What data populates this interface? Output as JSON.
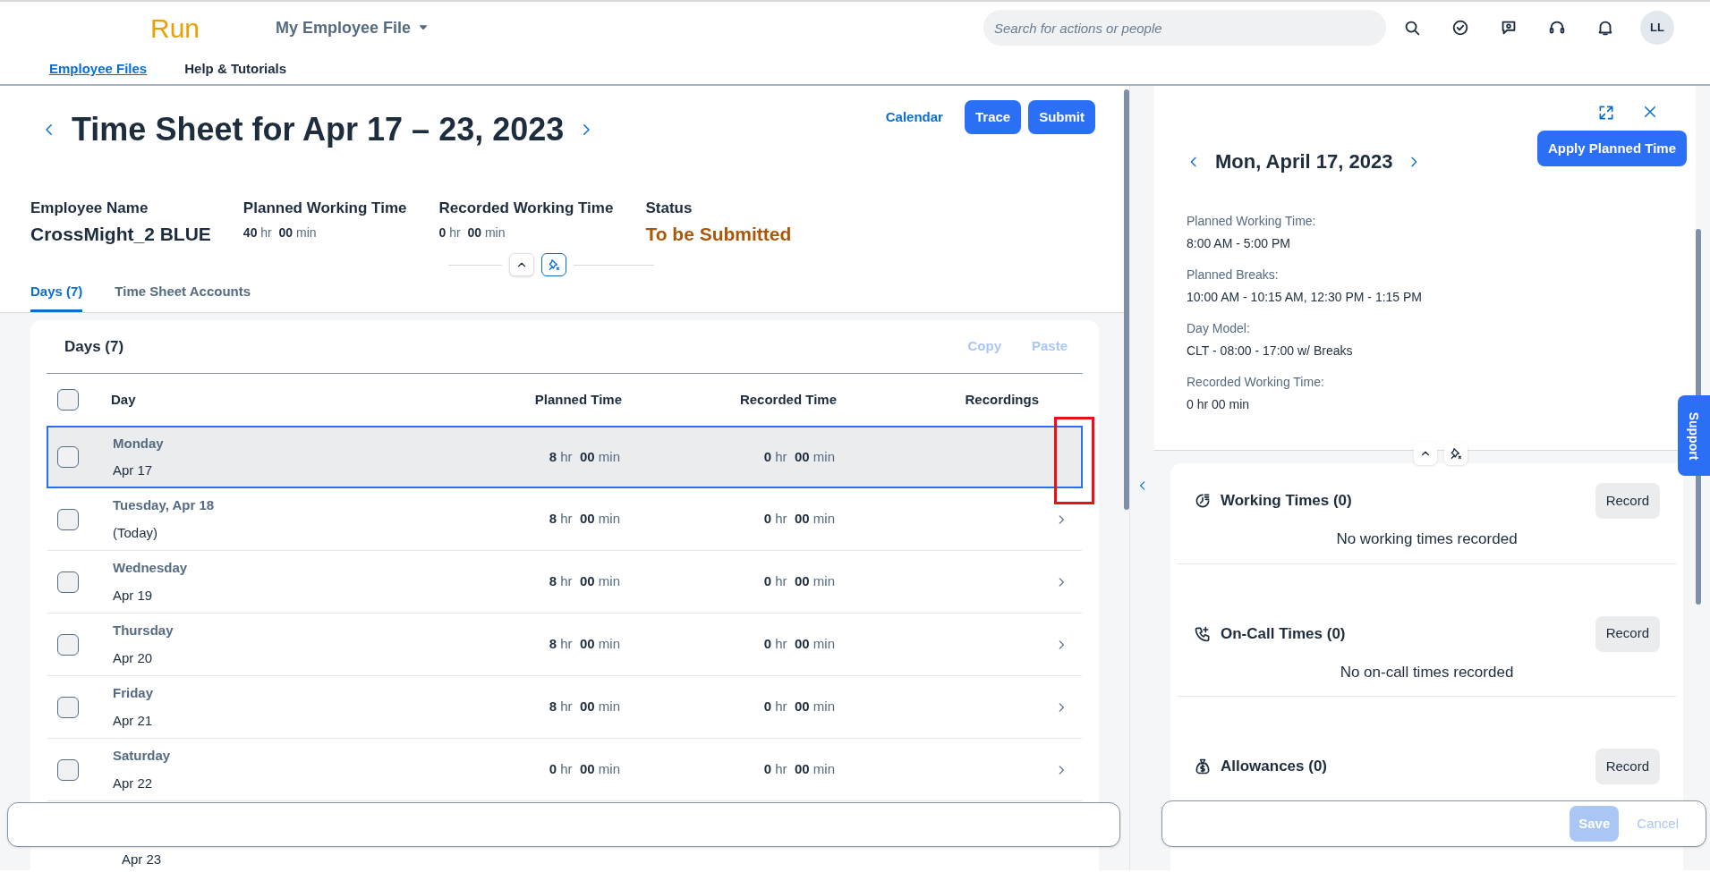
{
  "shell": {
    "logo": "Run",
    "app_menu": "My Employee File",
    "search": {
      "placeholder": "Search for actions or people"
    },
    "avatar": "LL",
    "nav": [
      {
        "label": "Employee Files",
        "selected": true
      },
      {
        "label": "Help & Tutorials",
        "selected": false
      }
    ]
  },
  "sheet": {
    "title": "Time Sheet for Apr 17 – 23, 2023",
    "actions": {
      "calendar": "Calendar",
      "trace": "Trace",
      "submit": "Submit"
    },
    "info": [
      {
        "label": "Employee Name",
        "kind": "name",
        "value": "CrossMight_2 BLUE"
      },
      {
        "label": "Planned Working Time",
        "kind": "duration",
        "hr": "40",
        "hr_unit": "hr",
        "min": "00",
        "min_unit": "min"
      },
      {
        "label": "Recorded Working Time",
        "kind": "duration",
        "hr": "0",
        "hr_unit": "hr",
        "min": "00",
        "min_unit": "min"
      },
      {
        "label": "Status",
        "kind": "status",
        "value": "To be Submitted"
      }
    ],
    "tabs": [
      {
        "label": "Days (7)",
        "selected": true
      },
      {
        "label": "Time Sheet Accounts",
        "selected": false
      }
    ],
    "days": {
      "title": "Days (7)",
      "copy": "Copy",
      "paste": "Paste",
      "header_checked": false,
      "columns": [
        "Day",
        "Planned Time",
        "Recorded Time",
        "Recordings"
      ],
      "rows": [
        {
          "day": "Monday",
          "sub": "Apr 17",
          "planned": [
            "8",
            "hr",
            "00",
            "min"
          ],
          "recorded": [
            "0",
            "hr",
            "00",
            "min"
          ],
          "selected": true,
          "checked": false
        },
        {
          "day": "Tuesday, Apr 18",
          "sub": "(Today)",
          "planned": [
            "8",
            "hr",
            "00",
            "min"
          ],
          "recorded": [
            "0",
            "hr",
            "00",
            "min"
          ],
          "selected": false,
          "checked": false
        },
        {
          "day": "Wednesday",
          "sub": "Apr 19",
          "planned": [
            "8",
            "hr",
            "00",
            "min"
          ],
          "recorded": [
            "0",
            "hr",
            "00",
            "min"
          ],
          "selected": false,
          "checked": false
        },
        {
          "day": "Thursday",
          "sub": "Apr 20",
          "planned": [
            "8",
            "hr",
            "00",
            "min"
          ],
          "recorded": [
            "0",
            "hr",
            "00",
            "min"
          ],
          "selected": false,
          "checked": false
        },
        {
          "day": "Friday",
          "sub": "Apr 21",
          "planned": [
            "8",
            "hr",
            "00",
            "min"
          ],
          "recorded": [
            "0",
            "hr",
            "00",
            "min"
          ],
          "selected": false,
          "checked": false
        },
        {
          "day": "Saturday",
          "sub": "Apr 22",
          "planned": [
            "0",
            "hr",
            "00",
            "min"
          ],
          "recorded": [
            "0",
            "hr",
            "00",
            "min"
          ],
          "selected": false,
          "checked": false
        }
      ],
      "partial_row": {
        "sub": "Apr 23"
      }
    }
  },
  "detail": {
    "title": "Mon, April 17, 2023",
    "apply": "Apply Planned Time",
    "facts": [
      {
        "label": "Planned Working Time:",
        "value": "8:00 AM - 5:00 PM"
      },
      {
        "label": "Planned Breaks:",
        "value": "10:00 AM - 10:15 AM, 12:30 PM - 1:15 PM"
      },
      {
        "label": "Day Model:",
        "value": "CLT - 08:00 - 17:00 w/ Breaks"
      },
      {
        "label": "Recorded Working Time:",
        "value": "0 hr 00 min"
      }
    ],
    "sections": [
      {
        "kind": "working",
        "title": "Working Times (0)",
        "button": "Record",
        "empty": "No working times recorded"
      },
      {
        "kind": "oncall",
        "title": "On-Call Times (0)",
        "button": "Record",
        "empty": "No on-call times recorded"
      },
      {
        "kind": "allowance",
        "title": "Allowances (0)",
        "button": "Record"
      }
    ],
    "footer": {
      "save": "Save",
      "save_disabled": true,
      "cancel": "Cancel"
    }
  },
  "support": "Support"
}
